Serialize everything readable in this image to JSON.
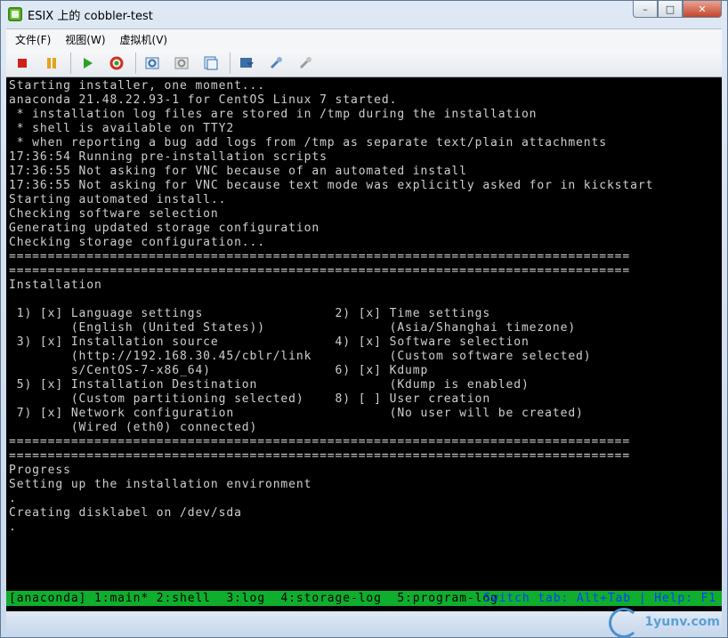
{
  "window": {
    "title": "ESIX 上的 cobbler-test",
    "controls": {
      "minimize": "–",
      "maximize": "□",
      "close": "✕"
    }
  },
  "menubar": {
    "items": [
      "文件(F)",
      "视图(W)",
      "虚拟机(V)"
    ]
  },
  "toolbar": {
    "buttons": [
      "stop",
      "pause",
      "play",
      "reset",
      "snapshot",
      "revert-snapshot",
      "manage-snapshots",
      "console",
      "settings",
      "network"
    ]
  },
  "console": {
    "lines": [
      "Starting installer, one moment...",
      "anaconda 21.48.22.93-1 for CentOS Linux 7 started.",
      " * installation log files are stored in /tmp during the installation",
      " * shell is available on TTY2",
      " * when reporting a bug add logs from /tmp as separate text/plain attachments",
      "17:36:54 Running pre-installation scripts",
      "17:36:55 Not asking for VNC because of an automated install",
      "17:36:55 Not asking for VNC because text mode was explicitly asked for in kickstart",
      "Starting automated install..",
      "Checking software selection",
      "Generating updated storage configuration",
      "Checking storage configuration...",
      "================================================================================",
      "================================================================================",
      "Installation",
      "",
      " 1) [x] Language settings                 2) [x] Time settings",
      "        (English (United States))                (Asia/Shanghai timezone)",
      " 3) [x] Installation source               4) [x] Software selection",
      "        (http://192.168.30.45/cblr/link          (Custom software selected)",
      "        s/CentOS-7-x86_64)                6) [x] Kdump",
      " 5) [x] Installation Destination                 (Kdump is enabled)",
      "        (Custom partitioning selected)    8) [ ] User creation",
      " 7) [x] Network configuration                    (No user will be created)",
      "        (Wired (eth0) connected)",
      "================================================================================",
      "================================================================================",
      "Progress",
      "Setting up the installation environment",
      ".",
      "Creating disklabel on /dev/sda",
      "."
    ],
    "status_left": "[anaconda] 1:main* 2:shell  3:log  4:storage-log  5:program-log",
    "status_right": "Switch tab: Alt+Tab | Help: F1"
  },
  "watermark": {
    "text": "1yunv.com"
  },
  "colors": {
    "console_bg": "#000000",
    "console_fg": "#cfcfcf",
    "status_bg": "#0fae2d",
    "status_right_fg": "#0040ff"
  }
}
